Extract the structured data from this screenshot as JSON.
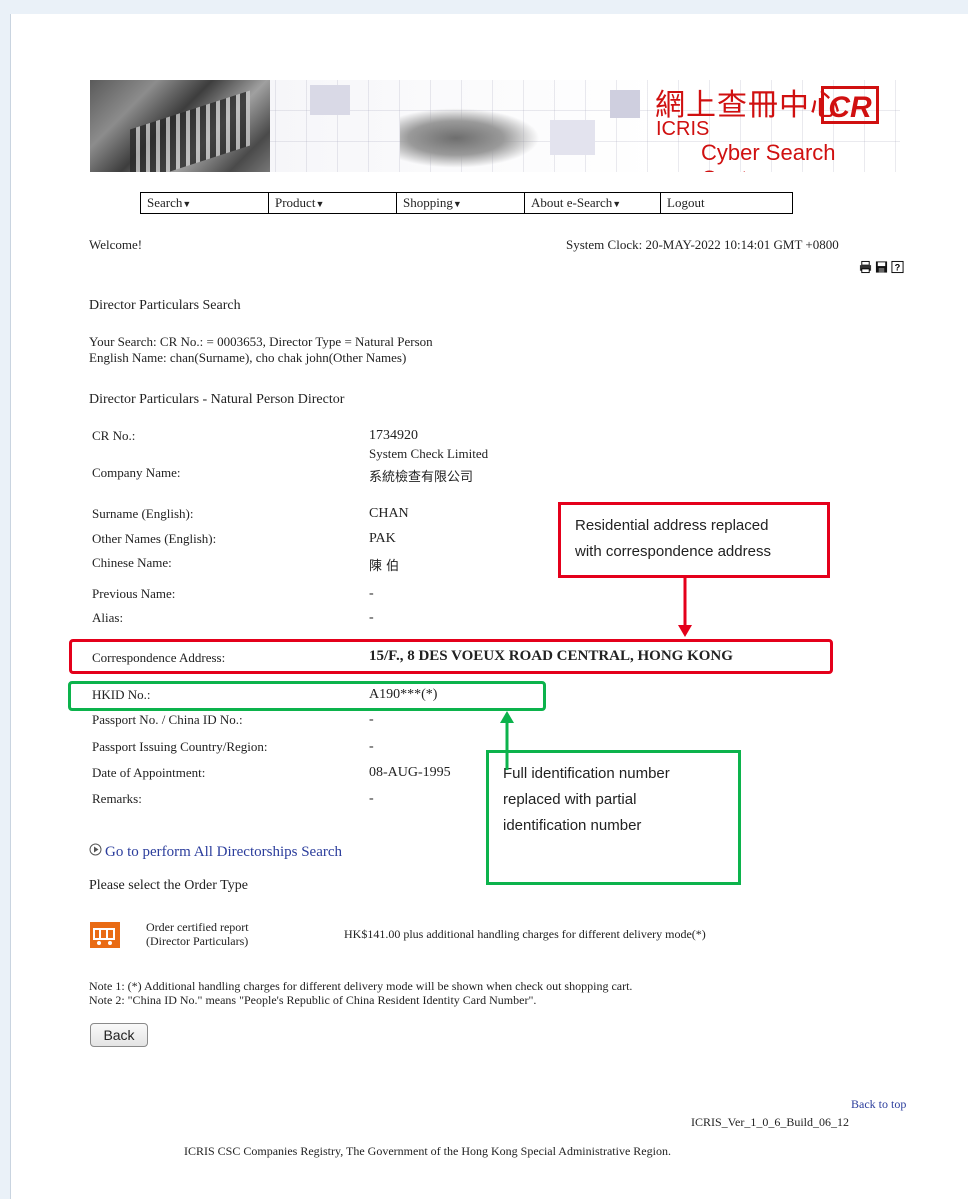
{
  "banner": {
    "zh_title": "網上查冊中心",
    "logo_text": "CR",
    "icris": "ICRIS",
    "subtitle": "Cyber Search Centre"
  },
  "nav": {
    "items": [
      {
        "label": "Search",
        "dropdown": true
      },
      {
        "label": "Product",
        "dropdown": true
      },
      {
        "label": "Shopping",
        "dropdown": true
      },
      {
        "label": "About e-Search",
        "dropdown": true
      },
      {
        "label": "Logout",
        "dropdown": false
      }
    ]
  },
  "header": {
    "welcome": "Welcome!",
    "clock": "System Clock: 20-MAY-2022 10:14:01 GMT +0800",
    "icons": [
      "print-icon",
      "save-icon",
      "help-icon"
    ]
  },
  "search": {
    "section_title": "Director Particulars Search",
    "your_search_line1": "Your Search: CR No.: = 0003653, Director Type = Natural Person",
    "your_search_line2": "English Name: chan(Surname), cho chak john(Other Names)"
  },
  "particulars": {
    "section_title": "Director Particulars - Natural Person Director",
    "rows": {
      "cr_no": {
        "label": "CR No.:",
        "value": "1734920"
      },
      "company_name": {
        "label": "Company Name:",
        "value_en": "System Check Limited",
        "value_zh": "系統檢查有限公司"
      },
      "surname": {
        "label": "Surname (English):",
        "value": "CHAN"
      },
      "other_names": {
        "label": "Other Names (English):",
        "value": "PAK"
      },
      "chinese_name": {
        "label": "Chinese Name:",
        "value": "陳 伯"
      },
      "previous_name": {
        "label": "Previous Name:",
        "value": "-"
      },
      "alias": {
        "label": "Alias:",
        "value": "-"
      },
      "correspondence_address": {
        "label": "Correspondence Address:",
        "value": "15/F., 8 DES VOEUX ROAD CENTRAL, HONG KONG"
      },
      "hkid": {
        "label": "HKID No.:",
        "value": "A190***(*)"
      },
      "passport": {
        "label": "Passport No. / China ID No.:",
        "value": "-"
      },
      "passport_country": {
        "label": "Passport Issuing Country/Region:",
        "value": "-"
      },
      "appointment_date": {
        "label": "Date of Appointment:",
        "value": "08-AUG-1995"
      },
      "remarks": {
        "label": "Remarks:",
        "value": "-"
      }
    }
  },
  "callouts": {
    "red_line1": "Residential address replaced",
    "red_line2": "with correspondence address",
    "green_line1": "Full identification number",
    "green_line2": "replaced with partial",
    "green_line3": "identification number"
  },
  "directorships_link": "Go to perform All Directorships Search",
  "order": {
    "title": "Please select the Order Type",
    "item_label_line1": "Order certified report",
    "item_label_line2": "(Director Particulars)",
    "price_text": "HK$141.00 plus additional handling charges for different delivery mode(*)"
  },
  "notes": {
    "note1": "Note 1: (*) Additional handling charges for different delivery mode will be shown when check out shopping cart.",
    "note2": "Note 2: \"China ID No.\" means \"People's Republic of China Resident Identity Card Number\"."
  },
  "back_button": "Back",
  "footer": {
    "back_to_top": "Back to top",
    "version": "ICRIS_Ver_1_0_6_Build_06_12",
    "copyright": "ICRIS CSC Companies Registry, The Government of the Hong Kong Special Administrative Region."
  },
  "colors": {
    "red": "#e4001b",
    "green": "#0cb34c",
    "link": "#2b3d9c",
    "brand_red": "#d01010"
  }
}
